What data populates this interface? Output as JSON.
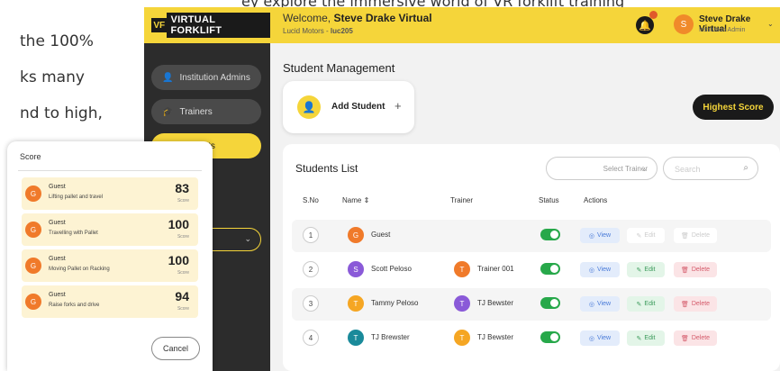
{
  "document": {
    "top_fragment": "ey explore the immersive world of VR forklift training",
    "lines": [
      "the 100%",
      "ks many",
      "nd to high,"
    ]
  },
  "app": {
    "logo_mark": "VF",
    "logo_text": "VIRTUAL FORKLIFT",
    "welcome_prefix": "Welcome, ",
    "welcome_name": "Steve Drake Virtual",
    "org_prefix": "Lucid Motors - ",
    "org_code": "luc205",
    "notification_count": "1",
    "user": {
      "initial": "S",
      "name": "Steve Drake Virtual",
      "role": "Institution Admin"
    },
    "nav": [
      {
        "label": "Institution Admins",
        "icon": "admin-icon"
      },
      {
        "label": "Trainers",
        "icon": "trainer-icon"
      },
      {
        "label": "Students",
        "icon": "student-icon"
      }
    ],
    "page_title": "Student Management",
    "add_student_label": "Add Student",
    "highest_score_label": "Highest Score",
    "list": {
      "title": "Students List",
      "trainer_select": "Select Trainer",
      "search_placeholder": "Search",
      "columns": [
        "S.No",
        "Name",
        "Trainer",
        "Status",
        "Actions"
      ],
      "rows": [
        {
          "sno": "1",
          "initial": "G",
          "name": "Guest",
          "avatar_color": "#f07a2a",
          "trainer": "",
          "trainer_initial": "",
          "trainer_color": "",
          "edit_enabled": false
        },
        {
          "sno": "2",
          "initial": "S",
          "name": "Scott Peloso",
          "avatar_color": "#8a5ad8",
          "trainer": "Trainer 001",
          "trainer_initial": "T",
          "trainer_color": "#f07a2a",
          "edit_enabled": true
        },
        {
          "sno": "3",
          "initial": "T",
          "name": "Tammy Peloso",
          "avatar_color": "#f5a623",
          "trainer": "TJ Bewster",
          "trainer_initial": "T",
          "trainer_color": "#8a5ad8",
          "edit_enabled": true
        },
        {
          "sno": "4",
          "initial": "T",
          "name": "TJ Brewster",
          "avatar_color": "#1a8a9a",
          "trainer": "TJ Bewster",
          "trainer_initial": "T",
          "trainer_color": "#f5a623",
          "edit_enabled": true
        }
      ],
      "actions": {
        "view": "View",
        "edit": "Edit",
        "delete": "Delete"
      }
    }
  },
  "score_modal": {
    "title": "Score",
    "score_label": "Score",
    "items": [
      {
        "initial": "G",
        "name": "Guest",
        "activity": "Lifting pallet and travel",
        "score": "83"
      },
      {
        "initial": "G",
        "name": "Guest",
        "activity": "Travelling with Pallet",
        "score": "100"
      },
      {
        "initial": "G",
        "name": "Guest",
        "activity": "Moving Pallet on Racking",
        "score": "100"
      },
      {
        "initial": "G",
        "name": "Guest",
        "activity": "Raise forks and drive",
        "score": "94"
      }
    ],
    "cancel_label": "Cancel"
  },
  "colors": {
    "brand_yellow": "#f5d53a",
    "sidebar": "#2c2c2c",
    "toggle_on": "#27a84a"
  }
}
